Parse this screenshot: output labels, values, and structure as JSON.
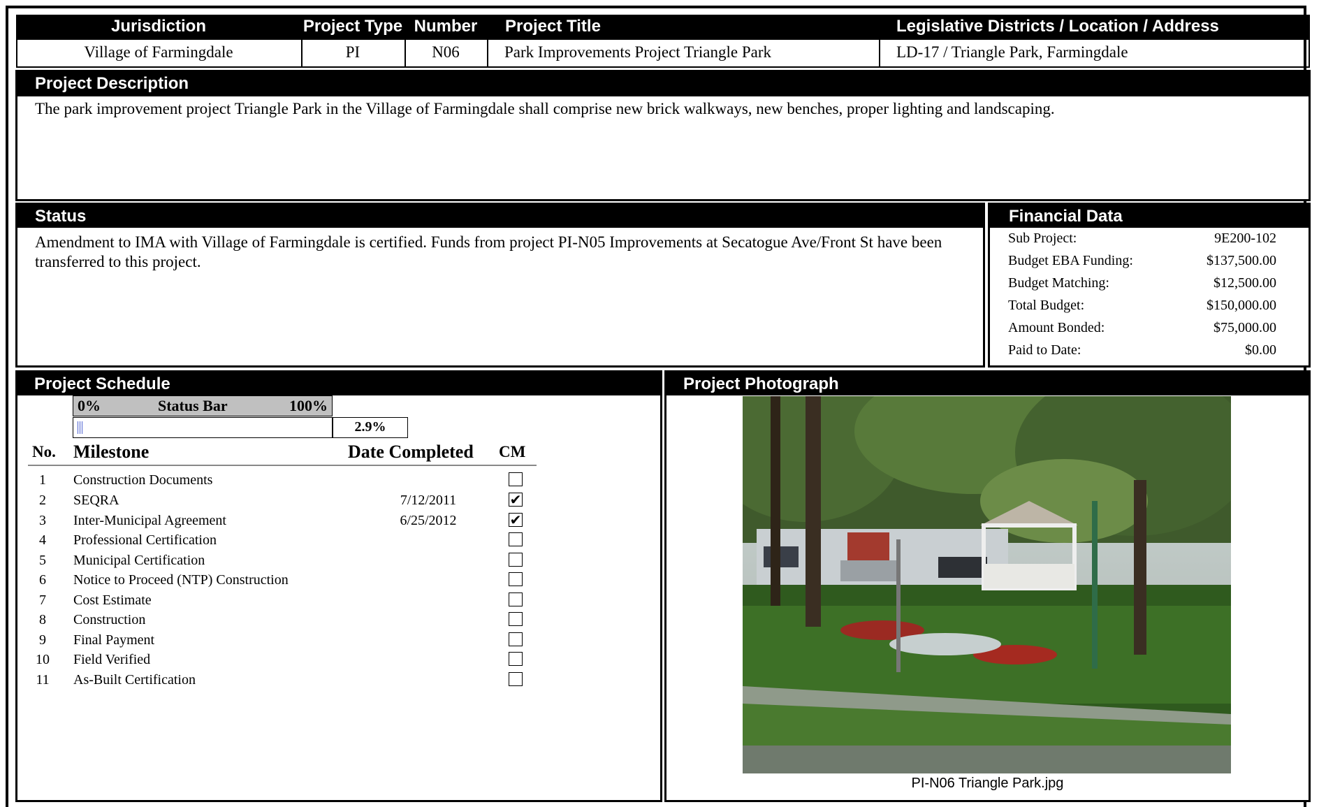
{
  "header": {
    "columns": [
      "Jurisdiction",
      "Project Type",
      "Number",
      "Project Title",
      "Legislative Districts / Location / Address"
    ],
    "values": [
      "Village of Farmingdale",
      "PI",
      "N06",
      "Park Improvements Project Triangle Park",
      "LD-17 / Triangle Park, Farmingdale"
    ]
  },
  "description": {
    "title": "Project Description",
    "text": "The park improvement project Triangle Park in the Village of Farmingdale shall comprise new brick walkways, new benches, proper lighting and landscaping."
  },
  "status": {
    "title": "Status",
    "text": "Amendment to IMA with Village of Farmingdale is certified. Funds from project PI-N05 Improvements at Secatogue Ave/Front St have been transferred to this project."
  },
  "financial": {
    "title": "Financial Data",
    "rows": [
      {
        "label": "Sub Project:",
        "value": "9E200-102"
      },
      {
        "label": "Budget EBA Funding:",
        "value": "$137,500.00"
      },
      {
        "label": "Budget Matching:",
        "value": "$12,500.00"
      },
      {
        "label": "Total Budget:",
        "value": "$150,000.00"
      },
      {
        "label": "Amount Bonded:",
        "value": "$75,000.00"
      },
      {
        "label": "Paid to Date:",
        "value": "$0.00"
      }
    ]
  },
  "schedule": {
    "title": "Project Schedule",
    "status_bar": {
      "min_label": "0%",
      "label": "Status Bar",
      "max_label": "100%",
      "percent_text": "2.9%",
      "progress": 0.029,
      "fill_color": "#4a5fd0"
    },
    "columns": {
      "no": "No.",
      "milestone": "Milestone",
      "date": "Date Completed",
      "cm": "CM"
    },
    "milestones": [
      {
        "no": "1",
        "name": "Construction Documents",
        "date": "",
        "checked": false
      },
      {
        "no": "2",
        "name": "SEQRA",
        "date": "7/12/2011",
        "checked": true
      },
      {
        "no": "3",
        "name": "Inter-Municipal Agreement",
        "date": "6/25/2012",
        "checked": true
      },
      {
        "no": "4",
        "name": "Professional Certification",
        "date": "",
        "checked": false
      },
      {
        "no": "5",
        "name": "Municipal Certification",
        "date": "",
        "checked": false
      },
      {
        "no": "6",
        "name": "Notice to Proceed (NTP) Construction",
        "date": "",
        "checked": false
      },
      {
        "no": "7",
        "name": "Cost Estimate",
        "date": "",
        "checked": false
      },
      {
        "no": "8",
        "name": "Construction",
        "date": "",
        "checked": false
      },
      {
        "no": "9",
        "name": "Final Payment",
        "date": "",
        "checked": false
      },
      {
        "no": "10",
        "name": "Field Verified",
        "date": "",
        "checked": false
      },
      {
        "no": "11",
        "name": "As-Built Certification",
        "date": "",
        "checked": false
      }
    ]
  },
  "photo": {
    "title": "Project Photograph",
    "caption": "PI-N06 Triangle Park.jpg"
  }
}
